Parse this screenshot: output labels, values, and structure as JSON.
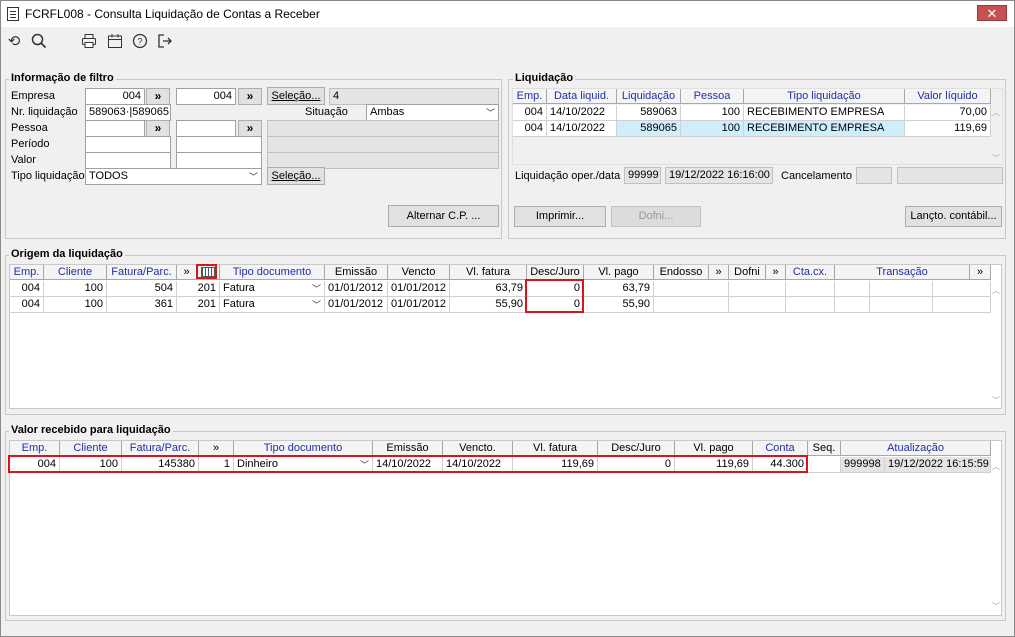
{
  "window": {
    "title": "FCRFL008 - Consulta Liquidação de Contas a Receber",
    "close_label": "✕"
  },
  "toolbar": {
    "icons": [
      "undo-icon",
      "search-icon",
      "print-icon",
      "calendar-icon",
      "help-icon",
      "exit-icon"
    ]
  },
  "filtro": {
    "title": "Informação de filtro",
    "empresa_label": "Empresa",
    "empresa_from": "004",
    "empresa_to": "004",
    "selecao_label": "Seleção...",
    "selecao_count": "4",
    "nrliq_label": "Nr. liquidação",
    "nrliq_value": "589063·|589065",
    "situacao_label": "Situação",
    "situacao_value": "Ambas",
    "pessoa_label": "Pessoa",
    "periodo_label": "Período",
    "valor_label": "Valor",
    "tipo_label": "Tipo liquidação",
    "tipo_value": "TODOS",
    "selecao2_label": "Seleção...",
    "alternar_label": "Alternar C.P. ...",
    "arrow": "»"
  },
  "liquidacao": {
    "title": "Liquidação",
    "headers": [
      "Emp.",
      "Data liquid.",
      "Liquidação",
      "Pessoa",
      "Tipo liquidação",
      "Valor líquido"
    ],
    "rows": [
      [
        "004",
        "14/10/2022",
        "589063",
        "100",
        "RECEBIMENTO EMPRESA",
        "70,00"
      ],
      [
        "004",
        "14/10/2022",
        "589065",
        "100",
        "RECEBIMENTO EMPRESA",
        "119,69"
      ]
    ],
    "oper_label": "Liquidação oper./data",
    "oper_user": "99999",
    "oper_datetime": "19/12/2022 16:16:00",
    "cancel_label": "Cancelamento",
    "imprimir_label": "Imprimir...",
    "dofni_label": "Dofni...",
    "lancto_label": "Lançto. contábil..."
  },
  "origem": {
    "title": "Origem da liquidação",
    "headers": [
      "Emp.",
      "Cliente",
      "Fatura/Parc.",
      "»",
      "",
      "Tipo documento",
      "Emissão",
      "Vencto",
      "Vl. fatura",
      "Desc/Juro",
      "Vl. pago",
      "Endosso",
      "»",
      "Dofni",
      "»",
      "Cta.cx.",
      "Transação",
      "»"
    ],
    "rows": [
      [
        "004",
        "100",
        "504",
        "201",
        "Fatura",
        "01/01/2012",
        "01/01/2012",
        "63,79",
        "0",
        "63,79"
      ],
      [
        "004",
        "100",
        "361",
        "201",
        "Fatura",
        "01/01/2012",
        "01/01/2012",
        "55,90",
        "0",
        "55,90"
      ]
    ]
  },
  "recebido": {
    "title": "Valor recebido para liquidação",
    "headers": [
      "Emp.",
      "Cliente",
      "Fatura/Parc.",
      "»",
      "Tipo documento",
      "Emissão",
      "Vencto.",
      "Vl. fatura",
      "Desc/Juro",
      "Vl. pago",
      "Conta",
      "Seq.",
      "Atualização"
    ],
    "rows": [
      [
        "004",
        "100",
        "145380",
        "1",
        "Dinheiro",
        "14/10/2022",
        "14/10/2022",
        "119,69",
        "0",
        "119,69",
        "44.300",
        "",
        "999998",
        "19/12/2022 16:15:59"
      ]
    ]
  }
}
